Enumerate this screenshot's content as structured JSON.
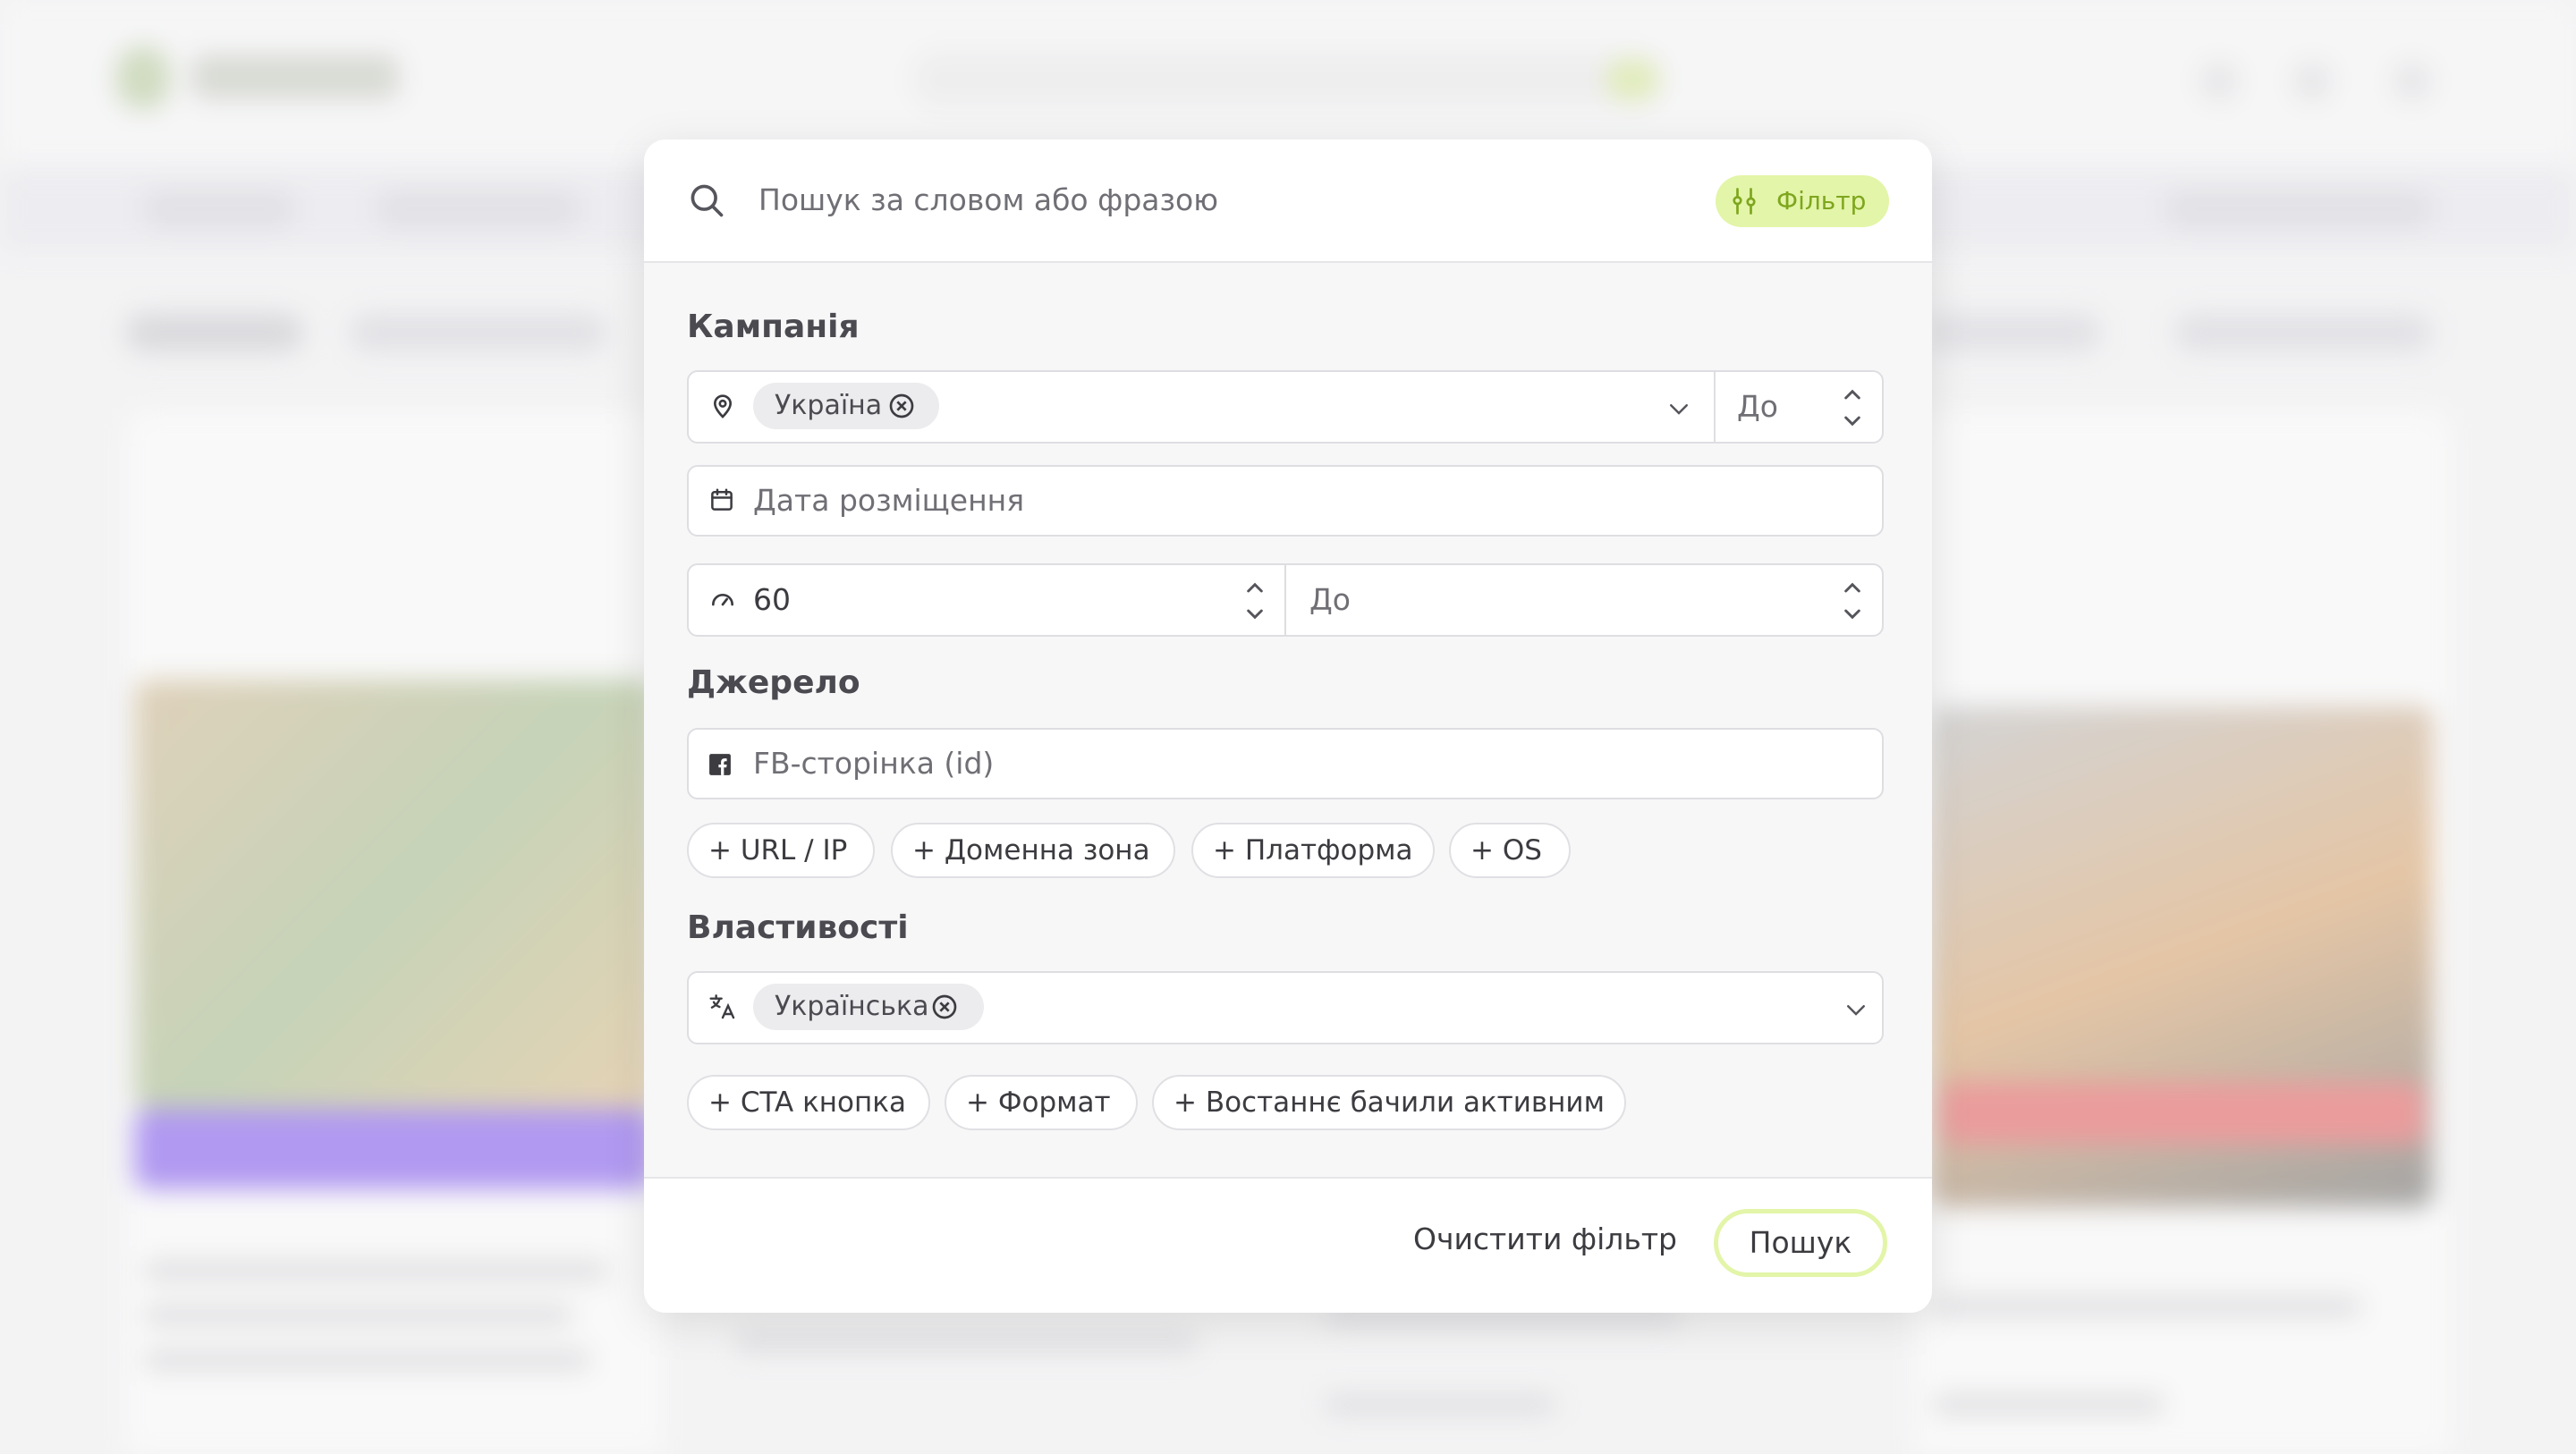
{
  "search": {
    "placeholder": "Пошук за словом або фразою",
    "filter_label": "Фільтр"
  },
  "campaign": {
    "title": "Кампанія",
    "country_chip": "Україна",
    "country_to_placeholder": "До",
    "date_placeholder": "Дата розміщення",
    "days_from_value": "60",
    "days_to_placeholder": "До"
  },
  "source": {
    "title": "Джерело",
    "fb_page_placeholder": "FB-сторінка (id)",
    "add_buttons": [
      "+ URL / IP",
      "+ Доменна зона",
      "+ Платформа",
      "+ OS"
    ]
  },
  "properties": {
    "title": "Властивості",
    "language_chip": "Українська",
    "add_buttons": [
      "+ CTA кнопка",
      "+ Формат",
      "+ Востаннє бачили активним"
    ]
  },
  "footer": {
    "clear_label": "Очистити фільтр",
    "search_label": "Пошук"
  },
  "colors": {
    "accent": "#e3f5a8",
    "accent_text": "#7ea61e"
  }
}
